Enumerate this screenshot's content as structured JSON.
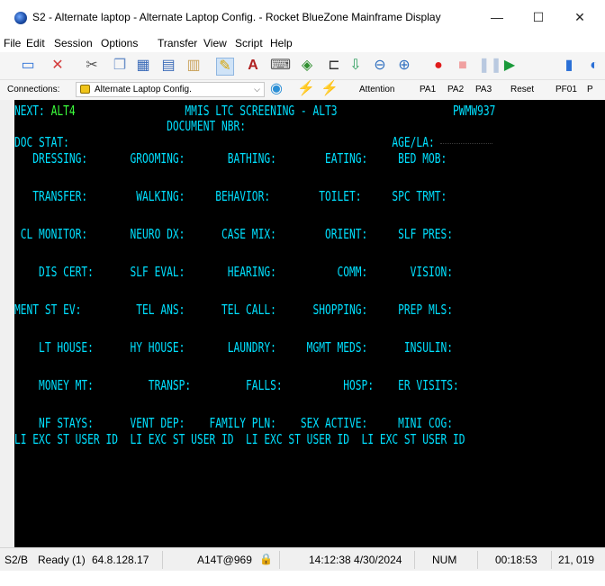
{
  "window": {
    "title": "S2 - Alternate laptop - Alternate Laptop Config. - Rocket BlueZone Mainframe Display",
    "minimize": "—",
    "maximize": "☐",
    "close": "✕"
  },
  "menu": {
    "items": [
      "File",
      "Edit",
      "Session",
      "Options",
      "Transfer",
      "View",
      "Script",
      "Help"
    ]
  },
  "toolbar": {
    "icons": [
      "monitor-icon",
      "disconnect-icon",
      "cut-icon",
      "copy-icon",
      "paste-icon",
      "print-icon",
      "clipboard-icon",
      "edit-icon",
      "font-icon",
      "keyboard-icon",
      "macro-icon",
      "capture-icon",
      "download-icon",
      "zoom-out-icon",
      "zoom-in-icon",
      "record-icon",
      "stop-icon",
      "pause-icon",
      "play-icon",
      "document-icon",
      "globe-icon"
    ]
  },
  "connections": {
    "label": "Connections:",
    "selected": "Alternate Laptop Config.",
    "buttons": [
      "Attention",
      "PA1",
      "PA2",
      "PA3",
      "Reset",
      "PF01",
      "P"
    ]
  },
  "terminal": {
    "next_label": "NEXT:",
    "next_value": " ALT4",
    "screen_title": "                  MMIS LTC SCREENING - ALT3                   PWMW937",
    "lines": [
      "                         DOCUMENT NBR:",
      "DOC STAT:                                                     AGE/LA:",
      "   DRESSING:       GROOMING:       BATHING:        EATING:     BED MOB:",
      "",
      "   TRANSFER:        WALKING:     BEHAVIOR:        TOILET:     SPC TRMT:",
      "",
      " CL MONITOR:       NEURO DX:      CASE MIX:        ORIENT:     SLF PRES:",
      "",
      "    DIS CERT:      SLF EVAL:       HEARING:          COMM:       VISION:",
      "",
      "MENT ST EV:         TEL ANS:      TEL CALL:      SHOPPING:     PREP MLS:",
      "",
      "    LT HOUSE:      HY HOUSE:       LAUNDRY:     MGMT MEDS:      INSULIN:",
      "",
      "    MONEY MT:         TRANSP:         FALLS:          HOSP:    ER VISITS:",
      "",
      "    NF STAYS:      VENT DEP:    FAMILY PLN:    SEX ACTIVE:     MINI COG:",
      "LI EXC ST USER ID  LI EXC ST USER ID  LI EXC ST USER ID  LI EXC ST USER ID"
    ]
  },
  "status": {
    "session": "S2/B",
    "ready": "Ready (1)",
    "ip": "64.8.128.17",
    "host": "A14T@969",
    "datetime": "14:12:38 4/30/2024",
    "num": "NUM",
    "elapsed": "00:18:53",
    "cursor": "21, 019"
  }
}
